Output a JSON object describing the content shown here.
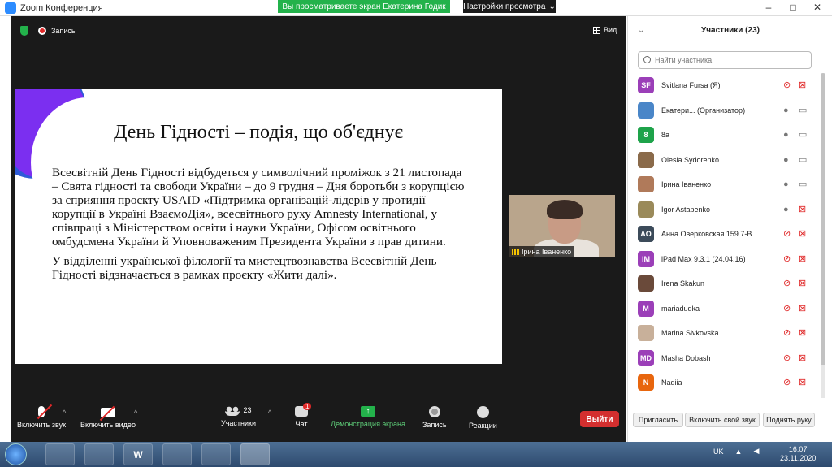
{
  "window": {
    "title": "Zoom Конференция",
    "minimize": "–",
    "maximize": "□",
    "close": "✕"
  },
  "share_banner": {
    "text": "Вы просматриваете экран Екатерина Годик",
    "view_options": "Настройки просмотра",
    "caret": "⌄"
  },
  "meeting_top": {
    "record_label": "Запись",
    "view_label": "Вид"
  },
  "slide": {
    "title": "День Гідності – подія, що об'єднує",
    "paragraph1": "Всесвітній День Гідності відбудеться у символічний проміжок з 21 листопада – Свята гідності та свободи України – до 9 грудня – Дня боротьби з корупцією за сприяння проєкту USAID «Підтримка організацій-лідерів у протидії корупції в Україні ВзаємоДія», всесвітнього руху Amnesty International, у співпраці з Міністерством освіти і науки України, Офісом освітнього омбудсмена України й Уповноваженим Президента України з прав дитини.",
    "paragraph2": "У відділенні української філології та мистецтвознавства Всесвітній День Гідності відзначається в рамках проєкту «Жити далі»."
  },
  "video_tile": {
    "name": "Ірина Іваненко"
  },
  "toolbar": {
    "audio": "Включить звук",
    "video": "Включить видео",
    "participants": "Участники",
    "participants_count": "23",
    "chat": "Чат",
    "chat_badge": "1",
    "share": "Демонстрация экрана",
    "share_arrow": "↑",
    "record": "Запись",
    "reactions": "Реакции",
    "leave": "Выйти",
    "caret": "^"
  },
  "panel": {
    "title": "Участники (23)",
    "collapse": "⌄",
    "search_placeholder": "Найти участника",
    "participants": [
      {
        "initials": "SF",
        "name": "Svitlana Fursa (Я)",
        "color": "#9b3fb8",
        "mic": "off",
        "cam": "off"
      },
      {
        "initials": "",
        "name": "Екатери... (Организатор)",
        "color": "#4a86c8",
        "mic": "on",
        "cam": "on"
      },
      {
        "initials": "8",
        "name": "8а",
        "color": "#1ea34a",
        "mic": "on",
        "cam": "on"
      },
      {
        "initials": "",
        "name": "Olesia Sydorenko",
        "color": "#8a6a4a",
        "mic": "on",
        "cam": "on"
      },
      {
        "initials": "",
        "name": "Ірина Іваненко",
        "color": "#b07a5a",
        "mic": "on",
        "cam": "on"
      },
      {
        "initials": "",
        "name": "Igor Astapenko",
        "color": "#9a8a5a",
        "mic": "on",
        "cam": "off"
      },
      {
        "initials": "AO",
        "name": "Анна Оверковская 159 7-В",
        "color": "#3c4b5a",
        "mic": "off",
        "cam": "off"
      },
      {
        "initials": "IM",
        "name": "iPad Max 9.3.1 (24.04.16)",
        "color": "#9b3fb8",
        "mic": "off",
        "cam": "off"
      },
      {
        "initials": "",
        "name": "Irena Skakun",
        "color": "#6a4a3a",
        "mic": "off",
        "cam": "off"
      },
      {
        "initials": "M",
        "name": "mariadudka",
        "color": "#9b3fb8",
        "mic": "off",
        "cam": "off"
      },
      {
        "initials": "",
        "name": "Marina Sivkovska",
        "color": "#c8b09a",
        "mic": "off",
        "cam": "off"
      },
      {
        "initials": "MD",
        "name": "Masha Dobash",
        "color": "#9b3fb8",
        "mic": "off",
        "cam": "off"
      },
      {
        "initials": "N",
        "name": "Nadiia",
        "color": "#e8660e",
        "mic": "off",
        "cam": "off"
      }
    ],
    "invite": "Пригласить",
    "unmute_self": "Включить свой звук",
    "raise_hand": "Поднять руку"
  },
  "taskbar": {
    "word": "W",
    "lang": "UK",
    "time": "16:07",
    "date": "23.11.2020"
  }
}
